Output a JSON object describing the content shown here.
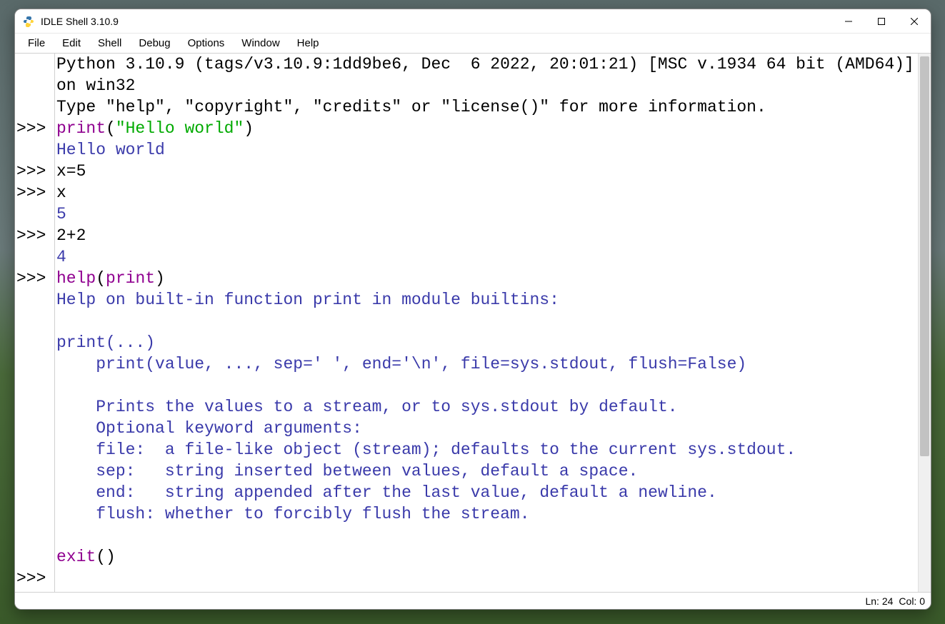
{
  "window": {
    "title": "IDLE Shell 3.10.9"
  },
  "menu": {
    "items": [
      "File",
      "Edit",
      "Shell",
      "Debug",
      "Options",
      "Window",
      "Help"
    ]
  },
  "shell": {
    "prompt": ">>>",
    "banner1": "Python 3.10.9 (tags/v3.10.9:1dd9be6, Dec  6 2022, 20:01:21) [MSC v.1934 64 bit (AMD64)] on win32",
    "banner2": "Type \"help\", \"copyright\", \"credits\" or \"license()\" for more information.",
    "line1_fn": "print",
    "line1_paren_open": "(",
    "line1_str": "\"Hello world\"",
    "line1_paren_close": ")",
    "line1_out": "Hello world",
    "line2_in": "x=5",
    "line3_in": "x",
    "line3_out": "5",
    "line4_in": "2+2",
    "line4_out": "4",
    "line5_fn": "help",
    "line5_paren_open": "(",
    "line5_arg": "print",
    "line5_paren_close": ")",
    "help_text": "Help on built-in function print in module builtins:\n\nprint(...)\n    print(value, ..., sep=' ', end='\\n', file=sys.stdout, flush=False)\n\n    Prints the values to a stream, or to sys.stdout by default.\n    Optional keyword arguments:\n    file:  a file-like object (stream); defaults to the current sys.stdout.\n    sep:   string inserted between values, default a space.\n    end:   string appended after the last value, default a newline.\n    flush: whether to forcibly flush the stream.\n",
    "line6_fn": "exit",
    "line6_paren_open": "(",
    "line6_paren_close": ")"
  },
  "status": {
    "ln": "Ln: 24",
    "col": "Col: 0"
  },
  "colors": {
    "builtin": "#900090",
    "string": "#00aa00",
    "output": "#3a3aaa"
  }
}
